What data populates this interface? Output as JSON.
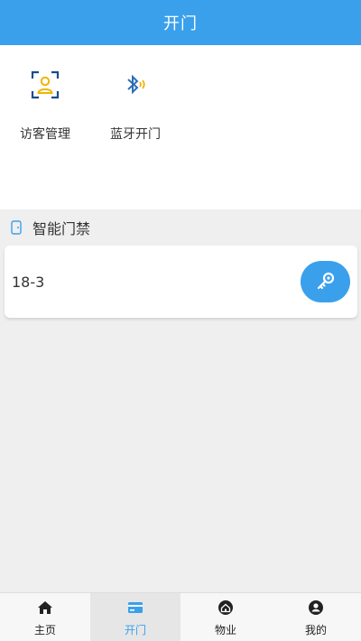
{
  "header": {
    "title": "开门"
  },
  "quick_actions": [
    {
      "label": "访客管理",
      "icon": "visitor-badge-icon"
    },
    {
      "label": "蓝牙开门",
      "icon": "bluetooth-icon"
    }
  ],
  "section": {
    "title": "智能门禁",
    "icon": "door-icon"
  },
  "door": {
    "name": "18-3",
    "action_icon": "key-icon"
  },
  "tabs": [
    {
      "label": "主页",
      "icon": "home-icon",
      "active": false
    },
    {
      "label": "开门",
      "icon": "card-icon",
      "active": true
    },
    {
      "label": "物业",
      "icon": "property-icon",
      "active": false
    },
    {
      "label": "我的",
      "icon": "user-icon",
      "active": false
    }
  ],
  "colors": {
    "accent": "#3aa0ec",
    "visitor_icon_blue": "#1a4c8c",
    "visitor_icon_yellow": "#f0b400"
  }
}
